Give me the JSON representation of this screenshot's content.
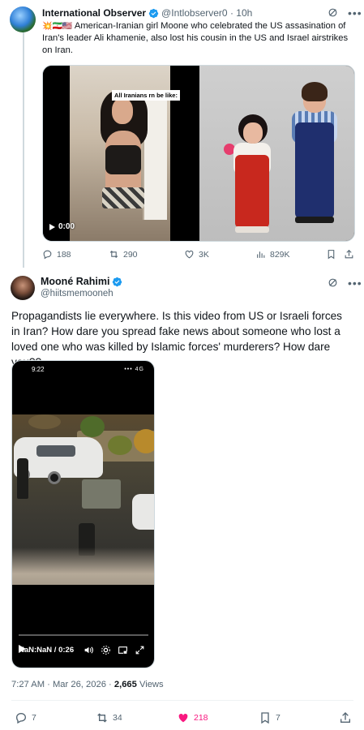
{
  "tweet1": {
    "author_name": "International Observer",
    "handle": "@Intlobserver0",
    "separator": "·",
    "time": "10h",
    "flags": "💥🇮🇷🇺🇸",
    "text": "American-Iranian girl Moone who celebrated the US assasination of Iran's leader Ali khamenie, also lost his cousin in the US and Israel airstrikes on Iran.",
    "video_caption": "All Iranians rn be like:",
    "video_time": "0:00",
    "replies": "188",
    "reposts": "290",
    "likes": "3K",
    "views": "829K"
  },
  "tweet2": {
    "author_name": "Mooné Rahimi",
    "handle": "@hiitsmemooneh",
    "text": "Propagandists lie everywhere. Is this video from US or Israeli forces in Iran? How dare you spread fake news about someone who lost a loved one who was killed by Islamic forces' murderers? How dare you??",
    "phone_time": "9:22",
    "phone_status": "••• 4G",
    "video_time": "NaN:NaN / 0:26",
    "timestamp": "7:27 AM · Mar 26, 2026 · ",
    "views_count": "2,665",
    "views_label": " Views",
    "replies": "7",
    "reposts": "34",
    "likes": "218",
    "bookmarks": "7"
  },
  "colors": {
    "verified": "#1d9bf0",
    "like": "#f91880",
    "secondary_text": "#536471"
  }
}
